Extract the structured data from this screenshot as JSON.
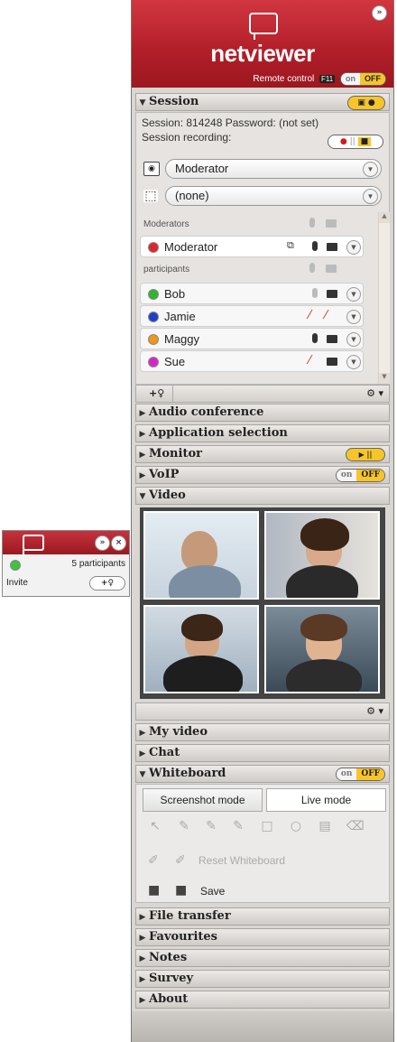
{
  "mini": {
    "participants": "5 participants",
    "invite": "Invite",
    "invite_btn": "+♀"
  },
  "header": {
    "brand": "netviewer",
    "remote_control": "Remote control",
    "hotkey": "F11",
    "toggle_on": "on",
    "toggle_off": "OFF"
  },
  "session": {
    "title": "Session",
    "line1": "Session: 814248  Password: (not set)",
    "recording": "Session recording:",
    "role_select": "Moderator",
    "view_select": "(none)",
    "group_moderators": "Moderators",
    "group_participants": "participants",
    "moderator_name": "Moderator",
    "participants": [
      {
        "name": "Bob",
        "color": "#2db52d"
      },
      {
        "name": "Jamie",
        "color": "#1f3fc7"
      },
      {
        "name": "Maggy",
        "color": "#f0961b"
      },
      {
        "name": "Sue",
        "color": "#d626c9"
      }
    ],
    "moderator_color": "#e0242c",
    "add_label": "+♀",
    "gear": "⚙ ▾"
  },
  "sections": {
    "audio": "Audio conference",
    "app": "Application selection",
    "monitor": "Monitor",
    "voip": "VoIP",
    "video": "Video",
    "myvideo": "My video",
    "chat": "Chat",
    "whiteboard": "Whiteboard",
    "filetransfer": "File transfer",
    "favourites": "Favourites",
    "notes": "Notes",
    "survey": "Survey",
    "about": "About"
  },
  "whiteboard": {
    "screenshot_mode": "Screenshot mode",
    "live_mode": "Live mode",
    "reset": "Reset Whiteboard",
    "save": "Save"
  },
  "colors": {
    "brand_red": "#b11e28",
    "toggle_yellow": "#f6c52a"
  }
}
